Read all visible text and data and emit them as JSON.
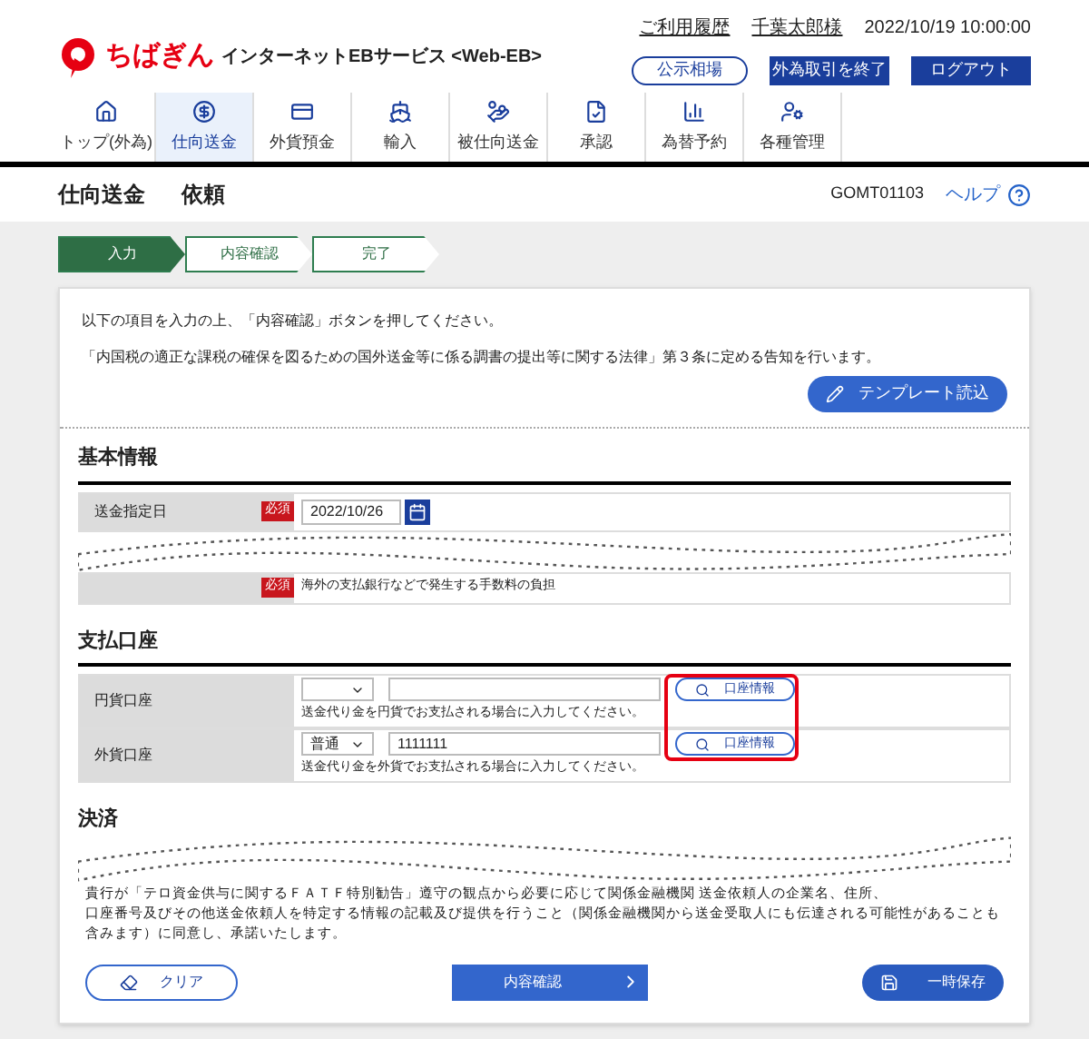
{
  "header": {
    "logo_text": "ちばぎん",
    "service_name": "インターネットEBサービス <Web-EB>",
    "links": [
      "ご利用履歴",
      "千葉太郎様"
    ],
    "datetime": "2022/10/19 10:00:00",
    "buttons": [
      {
        "label": "公示相場",
        "kind": "outline"
      },
      {
        "label": "外為取引を終了",
        "kind": "filled"
      },
      {
        "label": "ログアウト",
        "kind": "filled"
      }
    ]
  },
  "nav": {
    "items": [
      {
        "label": "トップ(外為)",
        "selected": false
      },
      {
        "label": "仕向送金",
        "selected": true
      },
      {
        "label": "外貨預金",
        "selected": false
      },
      {
        "label": "輸入",
        "selected": false
      },
      {
        "label": "被仕向送金",
        "selected": false
      },
      {
        "label": "承認",
        "selected": false
      },
      {
        "label": "為替予約",
        "selected": false
      },
      {
        "label": "各種管理",
        "selected": false
      }
    ]
  },
  "page": {
    "title": "仕向送金",
    "subtitle": "依頼",
    "screen_id": "GOMT01103",
    "help": "ヘルプ"
  },
  "steps": [
    {
      "label": "入力",
      "selected": true
    },
    {
      "label": "内容確認",
      "selected": false
    },
    {
      "label": "完了",
      "selected": false
    }
  ],
  "intro": [
    "以下の項目を入力の上、「内容確認」ボタンを押してください。",
    "「内国税の適正な課税の確保を図るための国外送金等に係る調書の提出等に関する法律」第３条に定める告知を行います。"
  ],
  "template_button": "テンプレート読込",
  "basic_info": {
    "heading": "基本情報",
    "date_row": {
      "label": "送金指定日",
      "required": "必須",
      "value": "2022/10/26"
    },
    "fee_row": {
      "required": "必須",
      "note": "海外の支払銀行などで発生する手数料の負担"
    }
  },
  "payment_account": {
    "heading": "支払口座",
    "rows": [
      {
        "label": "円貨口座",
        "type_value": "",
        "account_value": "",
        "lookup": "口座情報",
        "note": "送金代り金を円貨でお支払される場合に入力してください。"
      },
      {
        "label": "外貨口座",
        "type_value": "普通",
        "account_value": "1111111",
        "lookup": "口座情報",
        "note": "送金代り金を外貨でお支払される場合に入力してください。"
      }
    ]
  },
  "settlement": {
    "heading": "決済"
  },
  "consent": [
    "貴行が「テロ資金供与に関するＦＡＴＦ特別勧告」遵守の観点から必要に応じて関係金融機関",
    "送金依頼人の企業名、住所、",
    "口座番号及びその他送金依頼人を特定する情報の記載及び提供を行うこと（関係金融機関から送金受取人にも伝達される可能性があることも含みます）に同意し、承諾いたします。"
  ],
  "actions": {
    "clear": "クリア",
    "confirm": "内容確認",
    "save": "一時保存"
  }
}
